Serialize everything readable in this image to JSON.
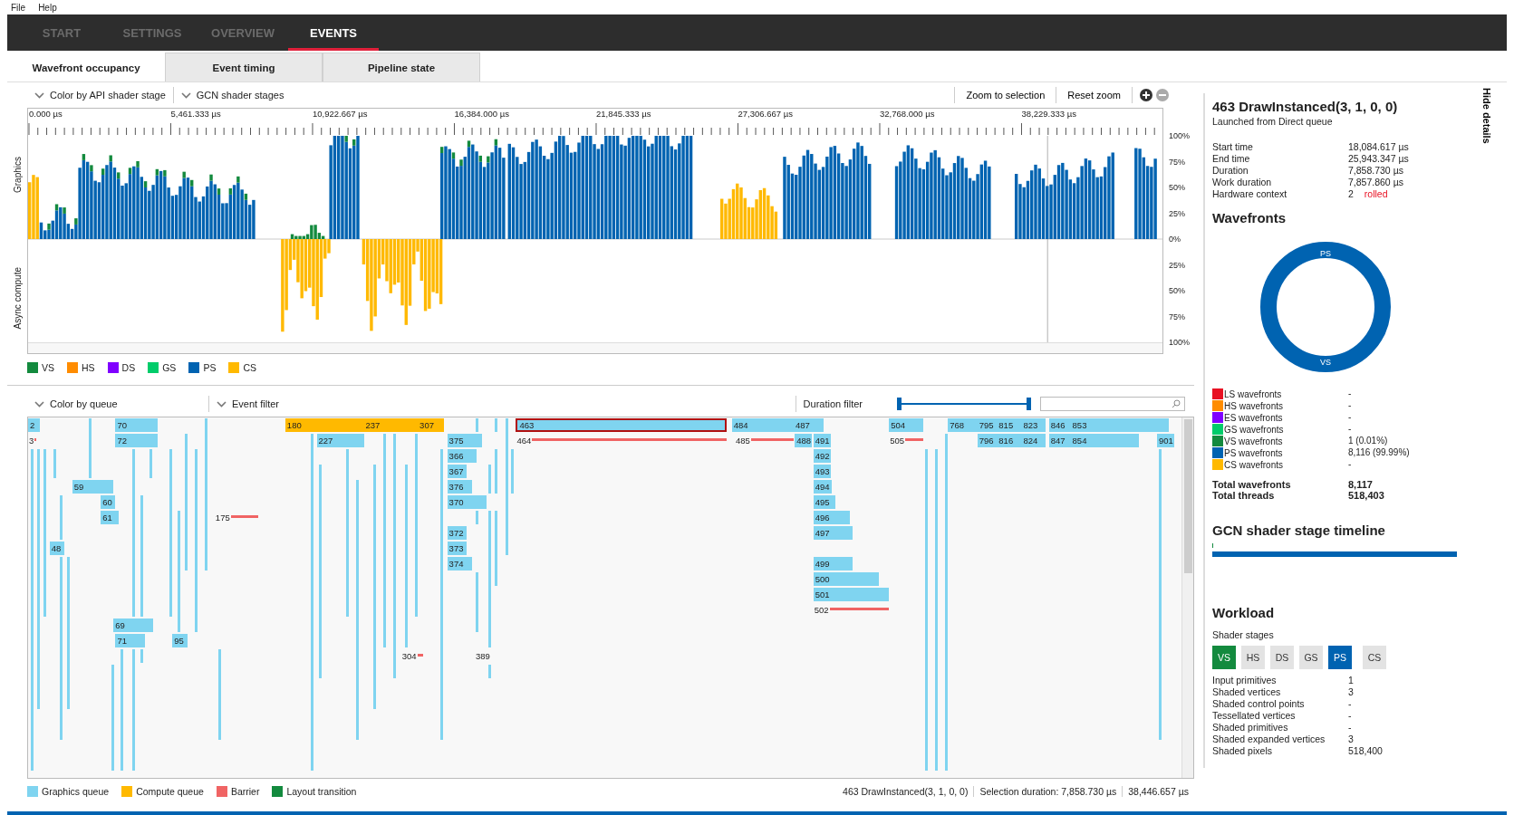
{
  "menu": [
    "File",
    "Help"
  ],
  "nav_tabs": [
    {
      "label": "START",
      "selected": false
    },
    {
      "label": "SETTINGS",
      "selected": false
    },
    {
      "label": "OVERVIEW",
      "selected": false
    },
    {
      "label": "EVENTS",
      "selected": true
    }
  ],
  "sub_tabs": [
    {
      "label": "Wavefront occupancy",
      "selected": true
    },
    {
      "label": "Event timing",
      "selected": false
    },
    {
      "label": "Pipeline state",
      "selected": false
    }
  ],
  "occupancy_toolbar": {
    "dropdowns": [
      "Color by API shader stage",
      "GCN shader stages"
    ],
    "buttons": [
      "Zoom to selection",
      "Reset zoom"
    ]
  },
  "occupancy_chart": {
    "side_labels": [
      "Graphics",
      "Async compute"
    ],
    "x_labels": [
      "0.000 µs",
      "5,461.333 µs",
      "10,922.667 µs",
      "16,384.000 µs",
      "21,845.333 µs",
      "27,306.667 µs",
      "32,768.000 µs",
      "38,229.333 µs"
    ],
    "y_labels": [
      "100%",
      "75%",
      "50%",
      "25%",
      "0%",
      "25%",
      "50%",
      "75%",
      "100%"
    ],
    "legend": [
      {
        "label": "VS",
        "color": "#138a3e"
      },
      {
        "label": "HS",
        "color": "#ff8c00"
      },
      {
        "label": "DS",
        "color": "#8000ff"
      },
      {
        "label": "GS",
        "color": "#00cc6a"
      },
      {
        "label": "PS",
        "color": "#0063b1"
      },
      {
        "label": "CS",
        "color": "#ffb900"
      }
    ]
  },
  "timeline_toolbar": {
    "dropdowns": [
      "Color by queue",
      "Event filter"
    ],
    "duration_label": "Duration filter",
    "duration_filter": {
      "level": 1
    }
  },
  "timeline": {
    "lanes": [
      [
        {
          "label": "2",
          "kind": "graphics",
          "selected": false
        },
        {
          "label": "70",
          "kind": "graphics",
          "selected": false
        },
        {
          "label": "180",
          "kind": "compute",
          "selected": false
        },
        {
          "label": "237",
          "kind": "compute",
          "selected": false
        },
        {
          "label": "307",
          "kind": "compute",
          "selected": false
        },
        {
          "label": "463",
          "kind": "graphics",
          "selected": true
        },
        {
          "label": "484",
          "kind": "graphics",
          "selected": false
        },
        {
          "label": "487",
          "kind": "graphics",
          "selected": false
        },
        {
          "label": "504",
          "kind": "graphics",
          "selected": false
        },
        {
          "label": "768",
          "kind": "graphics",
          "selected": false
        },
        {
          "label": "795",
          "kind": "graphics",
          "selected": false
        },
        {
          "label": "815",
          "kind": "graphics",
          "selected": false
        },
        {
          "label": "823",
          "kind": "graphics",
          "selected": false
        },
        {
          "label": "846",
          "kind": "graphics",
          "selected": false
        },
        {
          "label": "853",
          "kind": "graphics",
          "selected": false
        }
      ],
      [
        {
          "label": "3",
          "kind": "barrier",
          "selected": false
        },
        {
          "label": "72",
          "kind": "graphics",
          "selected": false
        },
        {
          "label": "227",
          "kind": "graphics",
          "selected": false
        },
        {
          "label": "375",
          "kind": "graphics",
          "selected": false
        },
        {
          "label": "464",
          "kind": "barrier",
          "selected": false
        },
        {
          "label": "485",
          "kind": "barrier",
          "selected": false
        },
        {
          "label": "488",
          "kind": "graphics",
          "selected": false
        },
        {
          "label": "491",
          "kind": "graphics",
          "selected": false
        },
        {
          "label": "505",
          "kind": "barrier",
          "selected": false
        },
        {
          "label": "796",
          "kind": "graphics",
          "selected": false
        },
        {
          "label": "816",
          "kind": "graphics",
          "selected": false
        },
        {
          "label": "824",
          "kind": "graphics",
          "selected": false
        },
        {
          "label": "847",
          "kind": "graphics",
          "selected": false
        },
        {
          "label": "854",
          "kind": "graphics",
          "selected": false
        },
        {
          "label": "901",
          "kind": "graphics",
          "selected": false
        }
      ],
      [
        {
          "label": "366",
          "kind": "graphics",
          "selected": false
        },
        {
          "label": "492",
          "kind": "graphics",
          "selected": false
        }
      ],
      [
        {
          "label": "367",
          "kind": "graphics",
          "selected": false
        },
        {
          "label": "493",
          "kind": "graphics",
          "selected": false
        }
      ],
      [
        {
          "label": "59",
          "kind": "graphics",
          "selected": false
        },
        {
          "label": "376",
          "kind": "graphics",
          "selected": false
        },
        {
          "label": "494",
          "kind": "graphics",
          "selected": false
        }
      ],
      [
        {
          "label": "60",
          "kind": "graphics",
          "selected": false
        },
        {
          "label": "370",
          "kind": "graphics",
          "selected": false
        },
        {
          "label": "495",
          "kind": "graphics",
          "selected": false
        }
      ],
      [
        {
          "label": "61",
          "kind": "graphics",
          "selected": false
        },
        {
          "label": "175",
          "kind": "barrier",
          "selected": false
        },
        {
          "label": "496",
          "kind": "graphics",
          "selected": false
        }
      ],
      [
        {
          "label": "372",
          "kind": "graphics",
          "selected": false
        },
        {
          "label": "497",
          "kind": "graphics",
          "selected": false
        }
      ],
      [
        {
          "label": "48",
          "kind": "graphics",
          "selected": false
        },
        {
          "label": "373",
          "kind": "graphics",
          "selected": false
        }
      ],
      [
        {
          "label": "374",
          "kind": "graphics",
          "selected": false
        },
        {
          "label": "499",
          "kind": "graphics",
          "selected": false
        }
      ],
      [
        {
          "label": "500",
          "kind": "graphics",
          "selected": false
        }
      ],
      [
        {
          "label": "501",
          "kind": "graphics",
          "selected": false
        }
      ],
      [
        {
          "label": "502",
          "kind": "barrier",
          "selected": false
        }
      ],
      [
        {
          "label": "69",
          "kind": "graphics",
          "selected": false
        }
      ],
      [
        {
          "label": "71",
          "kind": "graphics",
          "selected": false
        },
        {
          "label": "95",
          "kind": "graphics",
          "selected": false
        }
      ],
      [
        {
          "label": "304",
          "kind": "barrier",
          "selected": false
        },
        {
          "label": "389",
          "kind": "barrier",
          "selected": false
        }
      ]
    ],
    "legend": [
      {
        "label": "Graphics queue",
        "color": "#7fd4f0"
      },
      {
        "label": "Compute queue",
        "color": "#ffb900"
      },
      {
        "label": "Barrier",
        "color": "#f06464"
      },
      {
        "label": "Layout transition",
        "color": "#138a3e"
      }
    ]
  },
  "status_bar": {
    "event": "463 DrawInstanced(3, 1, 0, 0)",
    "selection_duration": "Selection duration:  7,858.730 µs",
    "total": "38,446.657 µs"
  },
  "details": {
    "hide_label": "Hide details",
    "title": "463 DrawInstanced(3, 1, 0, 0)",
    "subtitle": "Launched from Direct queue",
    "info": [
      {
        "label": "Start time",
        "value": "18,084.617 µs"
      },
      {
        "label": "End time",
        "value": "25,943.347 µs"
      },
      {
        "label": "Duration",
        "value": "7,858.730 µs"
      },
      {
        "label": "Work duration",
        "value": "7,857.860 µs"
      },
      {
        "label": "Hardware context",
        "value": "2",
        "note": "rolled"
      }
    ],
    "wavefronts_heading": "Wavefronts",
    "donut": {
      "labels": [
        "PS",
        "VS"
      ]
    },
    "wavefront_legend": [
      {
        "label": "LS wavefronts",
        "value": "-",
        "color": "#e81123"
      },
      {
        "label": "HS wavefronts",
        "value": "-",
        "color": "#ff8c00"
      },
      {
        "label": "ES wavefronts",
        "value": "-",
        "color": "#8000ff"
      },
      {
        "label": "GS wavefronts",
        "value": "-",
        "color": "#00cc6a"
      },
      {
        "label": "VS wavefronts",
        "value": "1 (0.01%)",
        "color": "#138a3e"
      },
      {
        "label": "PS wavefronts",
        "value": "8,116 (99.99%)",
        "color": "#0063b1"
      },
      {
        "label": "CS wavefronts",
        "value": "-",
        "color": "#ffb900"
      }
    ],
    "totals": [
      {
        "label": "Total wavefronts",
        "value": "8,117"
      },
      {
        "label": "Total threads",
        "value": "518,403"
      }
    ],
    "timeline_heading": "GCN shader stage timeline",
    "workload_heading": "Workload",
    "stages_label": "Shader stages",
    "stages": [
      {
        "label": "VS",
        "on": true,
        "color": "#138a3e"
      },
      {
        "label": "HS",
        "on": false
      },
      {
        "label": "DS",
        "on": false
      },
      {
        "label": "GS",
        "on": false
      },
      {
        "label": "PS",
        "on": true,
        "color": "#0063b1"
      },
      {
        "label": "CS",
        "on": false
      }
    ],
    "workload": [
      {
        "label": "Input primitives",
        "value": "1"
      },
      {
        "label": "Shaded vertices",
        "value": "3"
      },
      {
        "label": "Shaded control points",
        "value": "-"
      },
      {
        "label": "Tessellated vertices",
        "value": "-"
      },
      {
        "label": "Shaded primitives",
        "value": "-"
      },
      {
        "label": "Shaded expanded vertices",
        "value": "3"
      },
      {
        "label": "Shaded pixels",
        "value": "518,400"
      }
    ]
  }
}
